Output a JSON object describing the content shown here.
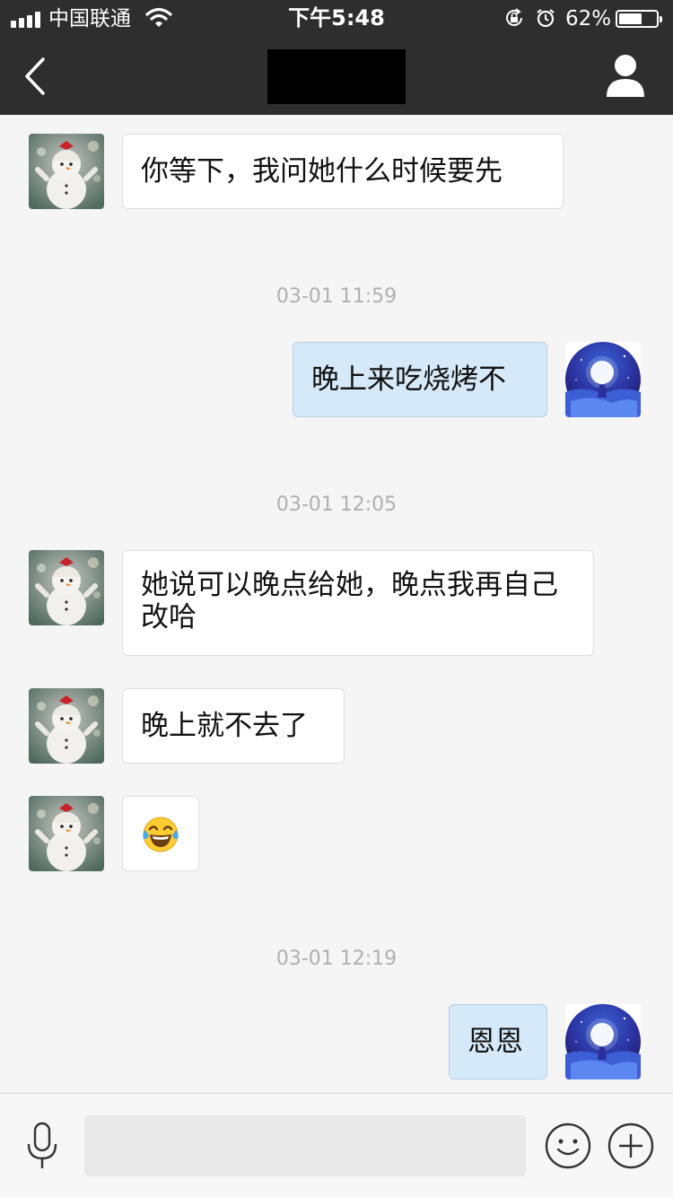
{
  "status_bar": {
    "carrier": "中国联通",
    "time": "下午5:48",
    "battery_percent": "62%",
    "battery_level": 0.62,
    "icons": [
      "signal-icon",
      "wifi-icon",
      "rotation-lock-icon",
      "alarm-icon",
      "battery-icon"
    ]
  },
  "nav": {
    "back_icon": "chevron-left-icon",
    "title_redacted": true,
    "profile_icon": "person-icon"
  },
  "messages": [
    {
      "type": "message",
      "side": "in",
      "text": "你等下，我问她什么时候要先"
    },
    {
      "type": "timestamp",
      "text": "03-01 11:59"
    },
    {
      "type": "message",
      "side": "out",
      "text": "晚上来吃烧烤不"
    },
    {
      "type": "timestamp",
      "text": "03-01 12:05"
    },
    {
      "type": "message",
      "side": "in",
      "text": "她说可以晚点给她，晚点我再自己改哈"
    },
    {
      "type": "message",
      "side": "in",
      "text": "晚上就不去了"
    },
    {
      "type": "message",
      "side": "in",
      "text": "😂"
    },
    {
      "type": "timestamp",
      "text": "03-01 12:19"
    },
    {
      "type": "message",
      "side": "out",
      "text": "恩恩"
    }
  ],
  "input_bar": {
    "icons": [
      "microphone-icon",
      "emoji-icon",
      "plus-icon"
    ],
    "placeholder": ""
  },
  "colors": {
    "nav_bg": "#2e2e2e",
    "chat_bg": "#f5f5f5",
    "incoming_bubble": "#ffffff",
    "outgoing_bubble": "#d6e9f8",
    "timestamp_text": "#b0b0b0"
  }
}
